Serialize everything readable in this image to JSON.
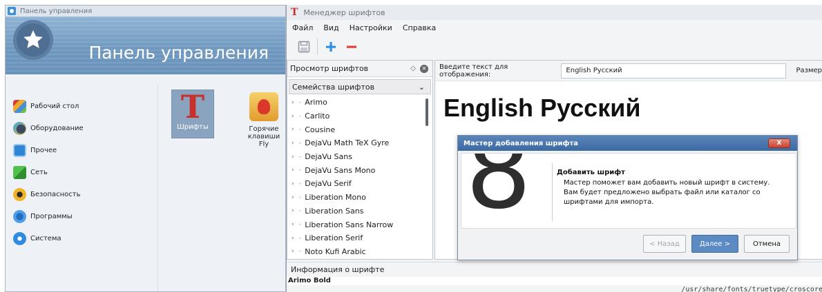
{
  "control_panel": {
    "window_title": "Панель управления",
    "banner_title": "Панель управления",
    "nav": [
      {
        "label": "Рабочий стол",
        "icon": "desktop-icon"
      },
      {
        "label": "Оборудование",
        "icon": "hardware-icon"
      },
      {
        "label": "Прочее",
        "icon": "other-icon"
      },
      {
        "label": "Сеть",
        "icon": "network-icon"
      },
      {
        "label": "Безопасность",
        "icon": "security-icon"
      },
      {
        "label": "Программы",
        "icon": "programs-icon"
      },
      {
        "label": "Система",
        "icon": "system-icon"
      }
    ],
    "tiles": {
      "fonts_label": "Шрифты",
      "fonts_glyph": "T",
      "hotkeys_label": "Горячие клавиши Fly"
    }
  },
  "font_manager": {
    "window_title": "Менеджер шрифтов",
    "title_glyph": "T",
    "menu": {
      "file": "Файл",
      "view": "Вид",
      "settings": "Настройки",
      "help": "Справка"
    },
    "toolbar": {
      "save": "save-icon",
      "add": "add-icon",
      "remove": "remove-icon",
      "add_color": "#2f8fe0",
      "remove_color": "#e0403a"
    },
    "browser": {
      "title": "Просмотр шрифтов",
      "combo": "Семейства шрифтов",
      "fonts": [
        "Arimo",
        "Carlito",
        "Cousine",
        "DejaVu Math TeX Gyre",
        "DejaVu Sans",
        "DejaVu Sans Mono",
        "DejaVu Serif",
        "Liberation Mono",
        "Liberation Sans",
        "Liberation Sans Narrow",
        "Liberation Serif",
        "Noto Kufi Arabic"
      ]
    },
    "preview": {
      "input_label": "Введите текст для отображения:",
      "input_value": "English Русский",
      "size_label": "Размер",
      "text": "English Русский"
    },
    "info": {
      "title": "Информация о шрифте",
      "font_name": "Arimo Bold",
      "path": "/usr/share/fonts/truetype/croscore"
    }
  },
  "wizard": {
    "title": "Мастер добавления шрифта",
    "close_label": "X",
    "art_glyph": "8",
    "heading": "Добавить шрифт",
    "line1": "Мастер поможет вам добавить новый шрифт в систему.",
    "line2": "Вам будет предложено выбрать файл или каталог со шрифтами для импорта.",
    "back": "< Назад",
    "next": "Далее >",
    "cancel": "Отмена",
    "accent_color": "#5c8bc3"
  }
}
